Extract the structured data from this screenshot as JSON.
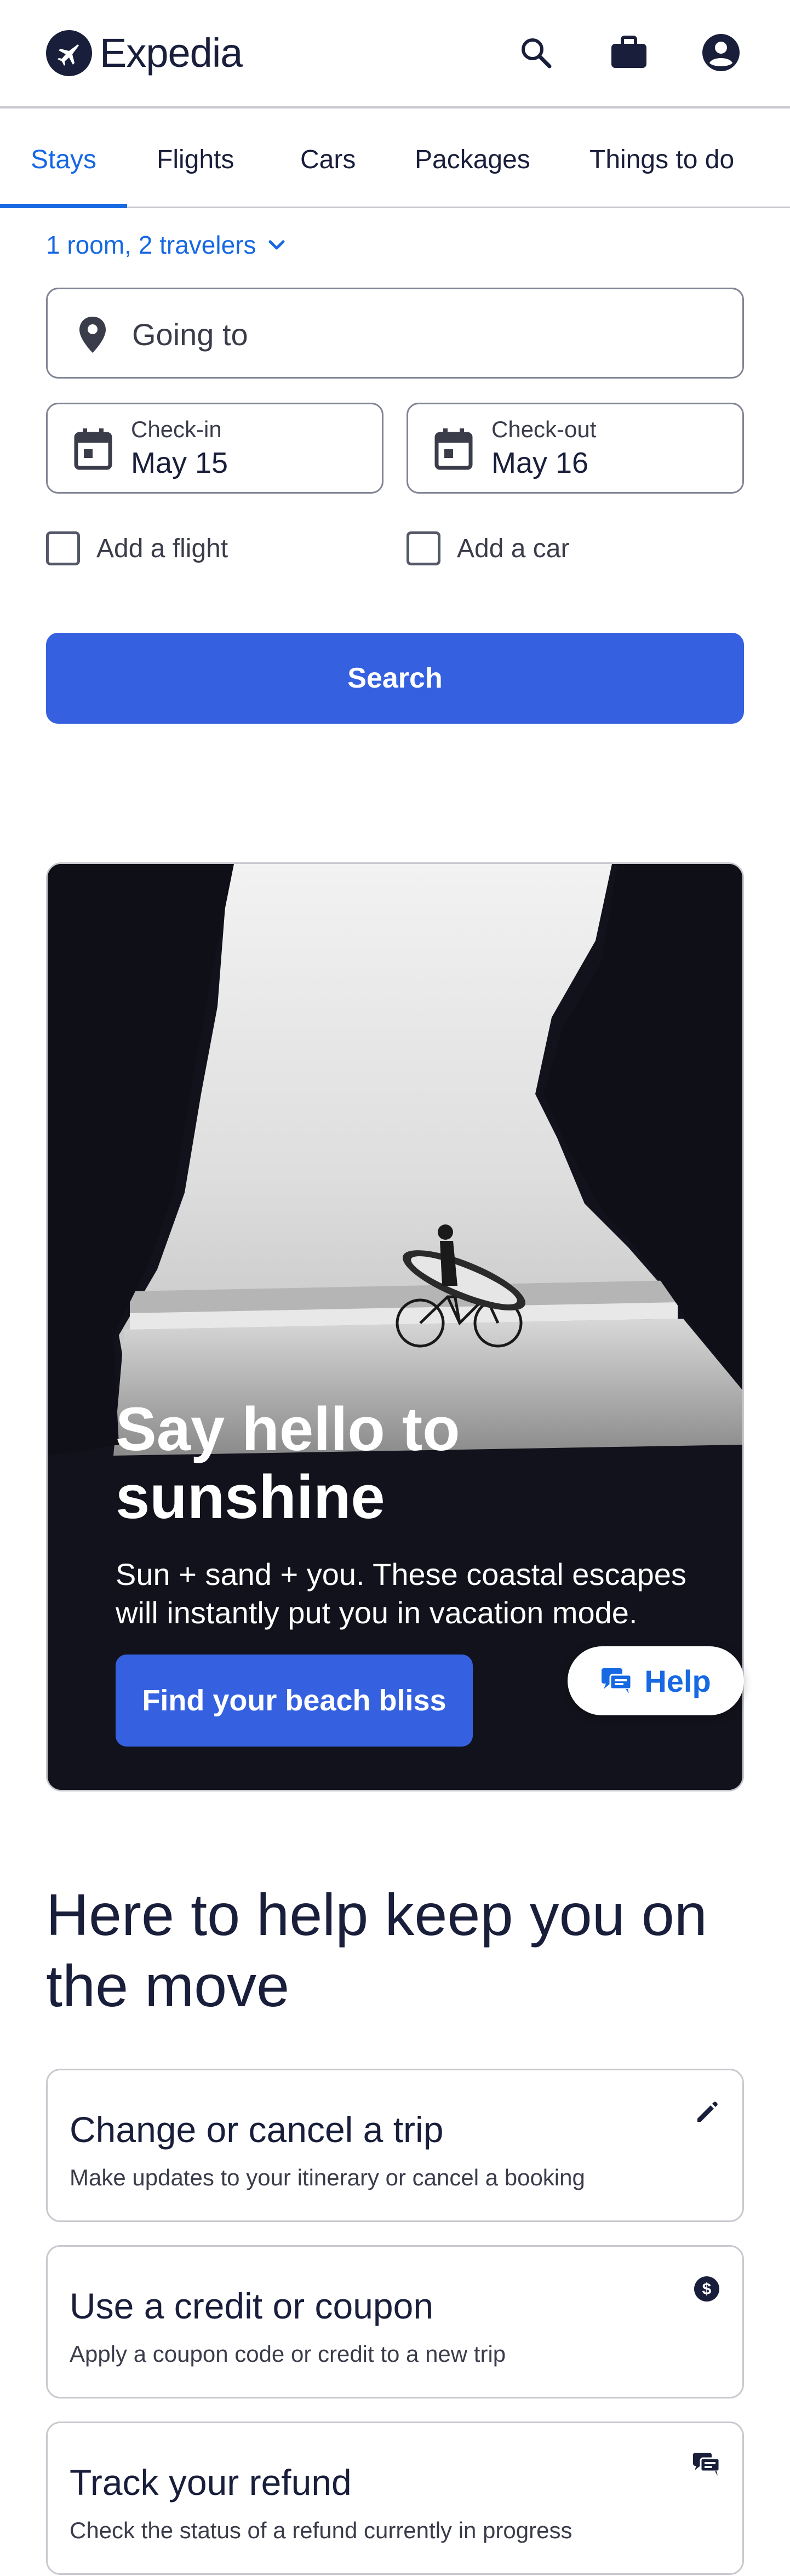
{
  "brand": {
    "name": "Expedia"
  },
  "header": {
    "icons": [
      "search-icon",
      "trips-briefcase-icon",
      "account-icon"
    ]
  },
  "tabs": [
    {
      "label": "Stays",
      "active": true
    },
    {
      "label": "Flights",
      "active": false
    },
    {
      "label": "Cars",
      "active": false
    },
    {
      "label": "Packages",
      "active": false
    },
    {
      "label": "Things to do",
      "active": false
    }
  ],
  "search_form": {
    "travelers": "1 room, 2 travelers",
    "destination_placeholder": "Going to",
    "checkin": {
      "label": "Check-in",
      "value": "May 15"
    },
    "checkout": {
      "label": "Check-out",
      "value": "May 16"
    },
    "add_flight": "Add a flight",
    "add_car": "Add a car",
    "search_label": "Search"
  },
  "hero": {
    "title": "Say hello to sunshine",
    "subtitle": "Sun + sand + you. These coastal escapes will instantly put you in vacation mode.",
    "cta": "Find your beach bliss"
  },
  "help_button": {
    "label": "Help"
  },
  "help_section": {
    "heading": "Here to help keep you on the move",
    "cards": [
      {
        "title": "Change or cancel a trip",
        "desc": "Make updates to your itinerary or cancel a booking",
        "icon": "pencil-icon"
      },
      {
        "title": "Use a credit or coupon",
        "desc": "Apply a coupon code or credit to a new trip",
        "icon": "dollar-icon"
      },
      {
        "title": "Track your refund",
        "desc": "Check the status of a refund currently in progress",
        "icon": "chat-icon"
      }
    ]
  },
  "colors": {
    "primary": "#1668e3",
    "button": "#3561e0",
    "text": "#191e3b",
    "hero_bg": "#12121c"
  }
}
